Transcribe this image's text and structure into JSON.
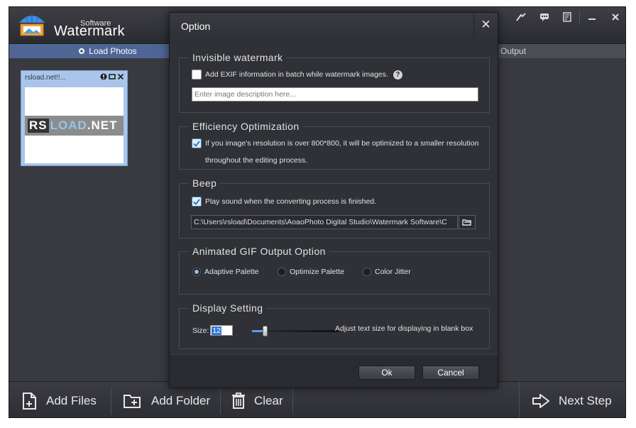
{
  "app": {
    "brand_small": "Software",
    "brand_big": "Watermark"
  },
  "steps": {
    "load": "Load Photos",
    "output": "Output"
  },
  "photo": {
    "name": "rsload.net!!...",
    "thumb_logo_rs": "RS",
    "thumb_logo_load": "LOAD",
    "thumb_logo_net": ".NET"
  },
  "bottom": {
    "add_files": "Add Files",
    "add_folder": "Add Folder",
    "clear": "Clear",
    "next_step": "Next Step"
  },
  "dialog": {
    "title": "Option",
    "invisible": {
      "title": "Invisible watermark",
      "exif_label": "Add EXIF information in batch while watermark images.",
      "exif_checked": false,
      "description_placeholder": "Enter image description here..."
    },
    "efficiency": {
      "title": "Efficiency Optimization",
      "line1": "If you image's resolution is over 800*800, it will be optimized to a smaller resolution",
      "line2": "throughout the editing process.",
      "checked": true
    },
    "beep": {
      "title": "Beep",
      "label": "Play sound when the converting process is finished.",
      "checked": true,
      "path": "C:\\Users\\rsload\\Documents\\AoaoPhoto Digital Studio\\Watermark Software\\C"
    },
    "gif": {
      "title": "Animated GIF Output Option",
      "options": [
        "Adaptive Palette",
        "Optimize Palette",
        "Color Jitter"
      ],
      "selected": "Adaptive Palette"
    },
    "display": {
      "title": "Display Setting",
      "size_label": "Size:",
      "size_value": "12",
      "hint": "Adjust text size for displaying in blank box"
    },
    "ok": "Ok",
    "cancel": "Cancel"
  },
  "colors": {
    "accent": "#4f6694",
    "check": "#3c7fb1",
    "selection": "#3875d7"
  }
}
